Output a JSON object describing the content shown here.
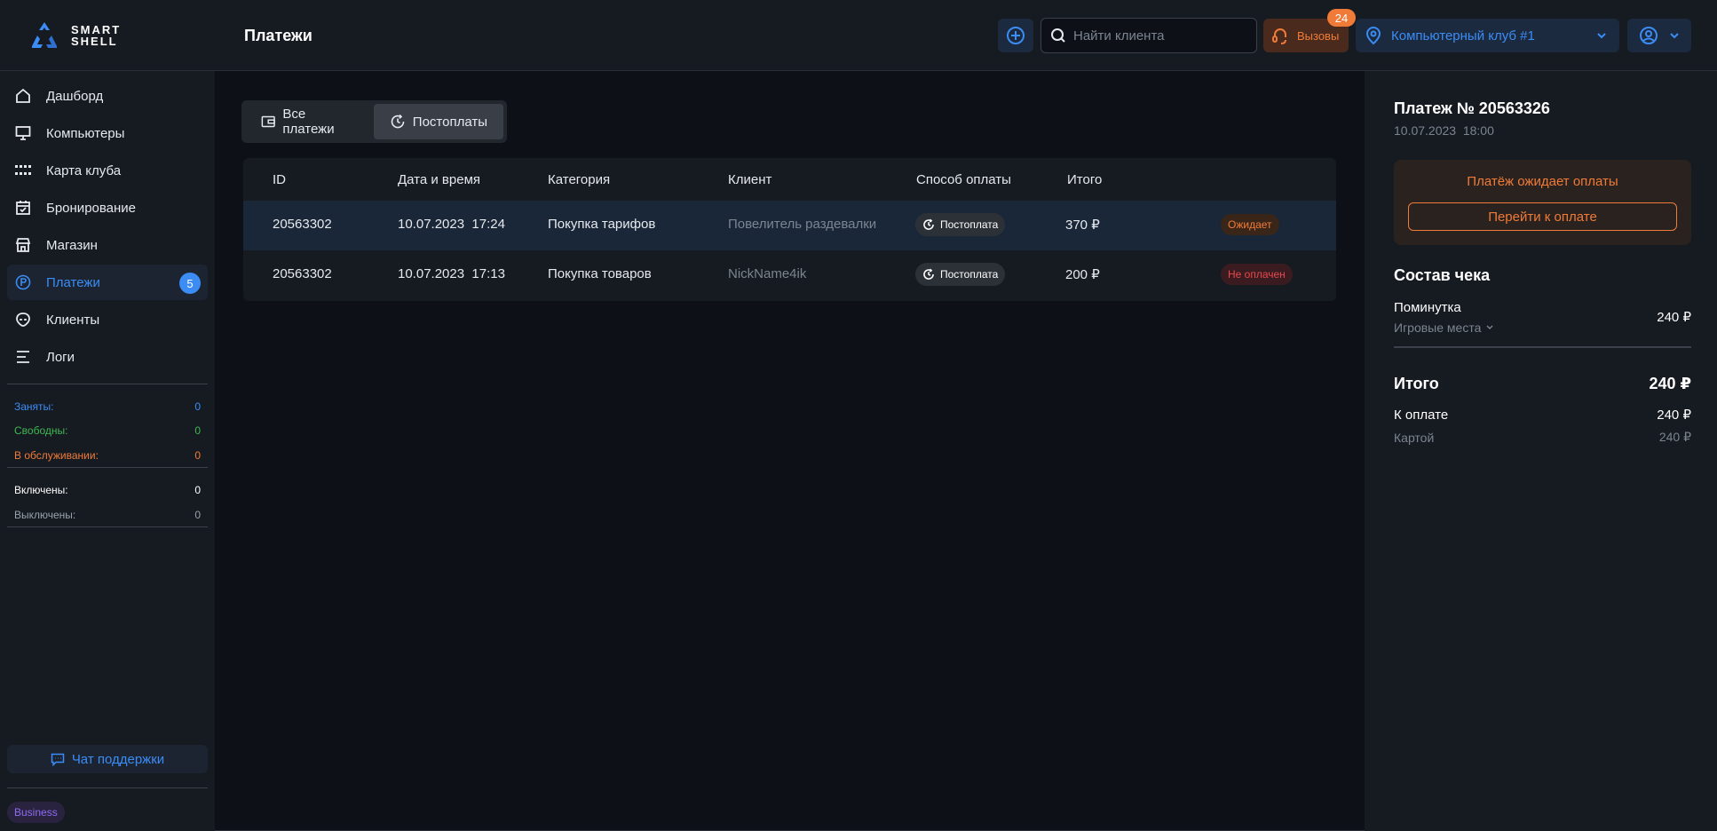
{
  "brand": {
    "line1": "SMART",
    "line2": "SHELL"
  },
  "header": {
    "title": "Платежи",
    "search_placeholder": "Найти клиента",
    "calls_label": "Вызовы",
    "calls_count": "24",
    "club_name": "Компьютерный клуб #1"
  },
  "sidebar": {
    "items": [
      {
        "label": "Дашборд",
        "icon": "home-icon"
      },
      {
        "label": "Компьютеры",
        "icon": "monitor-icon"
      },
      {
        "label": "Карта клуба",
        "icon": "grid-icon"
      },
      {
        "label": "Бронирование",
        "icon": "calendar-icon"
      },
      {
        "label": "Магазин",
        "icon": "store-icon"
      },
      {
        "label": "Платежи",
        "icon": "payment-icon",
        "badge": "5",
        "active": true
      },
      {
        "label": "Клиенты",
        "icon": "alien-icon"
      },
      {
        "label": "Логи",
        "icon": "list-icon"
      }
    ],
    "stats": [
      {
        "label": "Заняты:",
        "value": "0",
        "color": "#3b8cf5"
      },
      {
        "label": "Свободны:",
        "value": "0",
        "color": "#3fb950"
      },
      {
        "label": "В обслуживании:",
        "value": "0",
        "color": "#f07b38"
      },
      {
        "label": "Включены:",
        "value": "0",
        "color": "#ffffff"
      },
      {
        "label": "Выключены:",
        "value": "0",
        "color": "#9aa1ab"
      }
    ],
    "support_label": "Чат поддержки",
    "plan_label": "Business"
  },
  "tabs": [
    {
      "label": "Все платежи",
      "icon": "wallet-icon"
    },
    {
      "label": "Постоплаты",
      "icon": "postpay-icon",
      "active": true
    }
  ],
  "table": {
    "headers": [
      "ID",
      "Дата и время",
      "Категория",
      "Клиент",
      "Способ оплаты",
      "Итого"
    ],
    "rows": [
      {
        "id": "20563302",
        "datetime": "10.07.2023  17:24",
        "category": "Покупка тарифов",
        "client": "Повелитель раздевалки",
        "method": "Постоплата",
        "total": "370 ₽",
        "status": "Ожидает",
        "selected": true
      },
      {
        "id": "20563302",
        "datetime": "10.07.2023  17:13",
        "category": "Покупка товаров",
        "client": "NickName4ik",
        "method": "Постоплата",
        "total": "200 ₽",
        "status": "Не оплачен"
      }
    ]
  },
  "detail": {
    "title": "Платеж № 20563326",
    "date": "10.07.2023  18:00",
    "awaiting_text": "Платёж ожидает оплаты",
    "pay_button": "Перейти к оплате",
    "receipt_title": "Состав чека",
    "item_name": "Поминутка",
    "item_sub": "Игровые места",
    "item_price": "240 ₽",
    "total_label": "Итого",
    "total_value": "240 ₽",
    "to_pay_label": "К оплате",
    "to_pay_value": "240 ₽",
    "method_label": "Картой",
    "method_value": "240 ₽"
  },
  "colors": {
    "accent": "#3b8cf5",
    "warning": "#f07b38",
    "danger": "#e5484d",
    "success": "#3fb950",
    "plan": "#8f6bf0"
  }
}
